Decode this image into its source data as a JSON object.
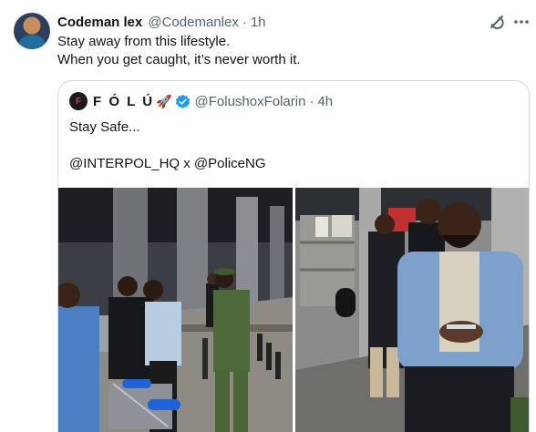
{
  "tweet": {
    "display_name": "Codeman lex",
    "apple_glyph": "",
    "handle": "@Codemanlex",
    "separator": "·",
    "time": "1h",
    "text_line1": "Stay away from this lifestyle.",
    "text_line2": "When you get caught, it’s never worth it."
  },
  "quoted": {
    "avatar_glyph": "F",
    "display_name": "F Ó L Ú",
    "rocket": "🚀",
    "handle": "@FolushoxFolarin",
    "separator": "·",
    "time": "4h",
    "text_line1": "Stay Safe...",
    "text_line2": "@INTERPOL_HQ x @PoliceNG"
  },
  "icons": {
    "grok": "grok-icon",
    "more": "more-icon",
    "verified": "verified-badge-icon"
  },
  "colors": {
    "text_primary": "#0f1419",
    "text_secondary": "#536471",
    "verified_blue": "#1d9bf0",
    "border": "#cfd9de"
  }
}
